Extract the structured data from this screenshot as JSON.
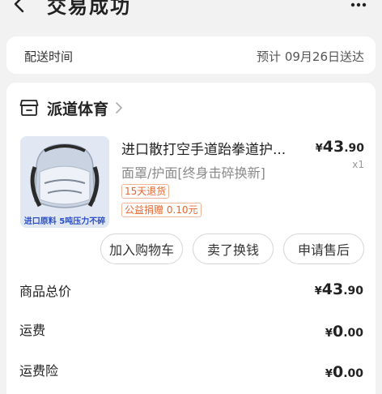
{
  "header": {
    "title": "交易成功"
  },
  "delivery": {
    "label": "配送时间",
    "value": "预计 09月26日送达"
  },
  "shop": {
    "name": "派道体育"
  },
  "product": {
    "title": "进口散打空手道跆拳道护...",
    "subtitle": "面罩/护面[终身击碎换新]",
    "image_caption": "进口原料 5吨压力不碎",
    "price_currency": "¥",
    "price_int": "43",
    "price_dec": ".90",
    "quantity": "x1",
    "tags": [
      "15天退货",
      "公益捐赠 0.10元"
    ]
  },
  "actions": {
    "add_to_cart": "加入购物车",
    "sell_for_cash": "卖了换钱",
    "after_sales": "申请售后"
  },
  "summary": {
    "total_label": "商品总价",
    "total_currency": "¥",
    "total_int": "43",
    "total_dec": ".90",
    "shipping_label": "运费",
    "shipping_currency": "¥",
    "shipping_int": "0",
    "shipping_dec": ".00",
    "insurance_label": "运费险",
    "insurance_currency": "¥",
    "insurance_int": "0",
    "insurance_dec": ".00"
  },
  "colors": {
    "background": "#f2f2f2",
    "card": "#ffffff",
    "tag": "#e8652e"
  }
}
